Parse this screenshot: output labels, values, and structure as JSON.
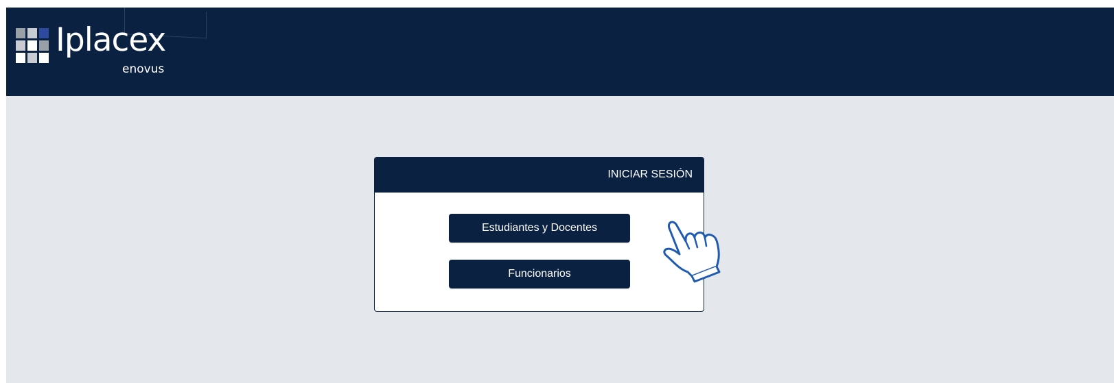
{
  "header": {
    "logo_text": "Iplacex",
    "logo_subtext": "enovus",
    "background_color": "#0b2142"
  },
  "login": {
    "title": "INICIAR SESIÓN",
    "buttons": [
      {
        "label": "Estudiantes y Docentes"
      },
      {
        "label": "Funcionarios"
      }
    ],
    "pointer_icon": "hand-pointer-icon"
  },
  "colors": {
    "navy": "#0b2142",
    "page_bg": "#e4e8ec",
    "hand_stroke": "#1f5bb0"
  }
}
